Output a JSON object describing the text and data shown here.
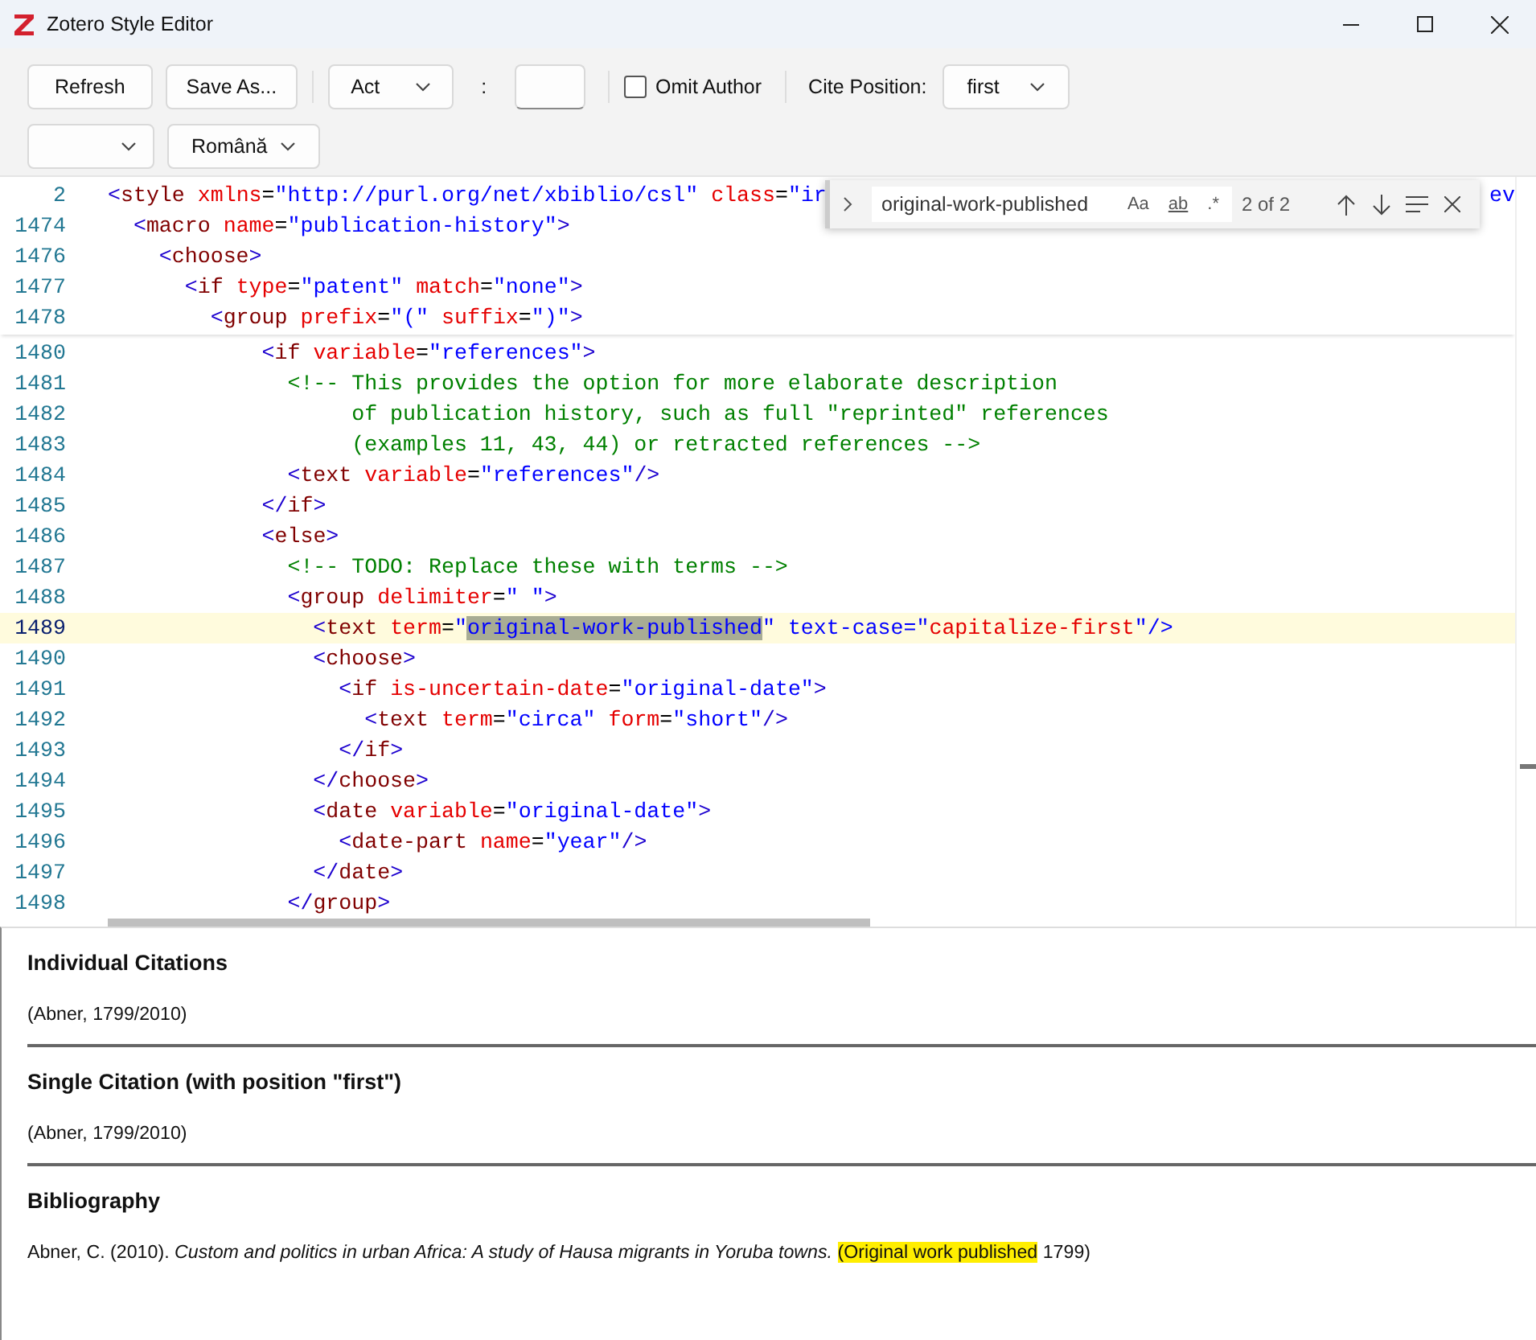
{
  "window": {
    "title": "Zotero Style Editor"
  },
  "toolbar": {
    "refresh": "Refresh",
    "save_as": "Save As...",
    "locator_type": "Act",
    "separator": ":",
    "omit_author": {
      "label": "Omit Author",
      "checked": false
    },
    "cite_position": {
      "label": "Cite Position:",
      "value": "first"
    },
    "language": "Română"
  },
  "editor": {
    "sticky_lines": [
      {
        "number": "2",
        "segments": [
          {
            "kind": "markup",
            "text": "<style xmlns=\"http://purl.org/net/xbiblio/csl\" class=\"ir"
          }
        ],
        "tail": "ev",
        "current": false
      },
      {
        "number": "1474",
        "segments": [
          {
            "kind": "markup",
            "text": "  <macro name=\"publication-history\">"
          }
        ],
        "current": false
      },
      {
        "number": "1476",
        "segments": [
          {
            "kind": "markup",
            "text": "    <choose>"
          }
        ],
        "current": false
      },
      {
        "number": "1477",
        "segments": [
          {
            "kind": "markup",
            "text": "      <if type=\"patent\" match=\"none\">"
          }
        ],
        "current": false
      },
      {
        "number": "1478",
        "segments": [
          {
            "kind": "markup",
            "text": "        <group prefix=\"(\" suffix=\")\">"
          }
        ],
        "current": false
      }
    ],
    "lines": [
      {
        "number": "1480",
        "segments": [
          {
            "kind": "markup",
            "text": "            <if variable=\"references\">"
          }
        ],
        "current": false
      },
      {
        "number": "1481",
        "segments": [
          {
            "kind": "comment",
            "text": "              <!-- This provides the option for more elaborate description"
          }
        ],
        "current": false
      },
      {
        "number": "1482",
        "segments": [
          {
            "kind": "comment",
            "text": "                   of publication history, such as full \"reprinted\" references"
          }
        ],
        "current": false
      },
      {
        "number": "1483",
        "segments": [
          {
            "kind": "comment",
            "text": "                   (examples 11, 43, 44) or retracted references -->"
          }
        ],
        "current": false
      },
      {
        "number": "1484",
        "segments": [
          {
            "kind": "markup",
            "text": "              <text variable=\"references\"/>"
          }
        ],
        "current": false
      },
      {
        "number": "1485",
        "segments": [
          {
            "kind": "markup",
            "text": "            </if>"
          }
        ],
        "current": false
      },
      {
        "number": "1486",
        "segments": [
          {
            "kind": "markup",
            "text": "            <else>"
          }
        ],
        "current": false
      },
      {
        "number": "1487",
        "segments": [
          {
            "kind": "comment",
            "text": "              <!-- TODO: Replace these with terms -->"
          }
        ],
        "current": false
      },
      {
        "number": "1488",
        "segments": [
          {
            "kind": "markup",
            "text": "              <group delimiter=\" \">"
          }
        ],
        "current": false
      },
      {
        "number": "1489",
        "segments": [
          {
            "kind": "markup",
            "text": "                <text term=\""
          },
          {
            "kind": "match",
            "text": "original-work-published"
          },
          {
            "kind": "markup",
            "text": "\" text-case=\"capitalize-first\"/>"
          }
        ],
        "current": true
      },
      {
        "number": "1490",
        "segments": [
          {
            "kind": "markup",
            "text": "                <choose>"
          }
        ],
        "current": false
      },
      {
        "number": "1491",
        "segments": [
          {
            "kind": "markup",
            "text": "                  <if is-uncertain-date=\"original-date\">"
          }
        ],
        "current": false
      },
      {
        "number": "1492",
        "segments": [
          {
            "kind": "markup",
            "text": "                    <text term=\"circa\" form=\"short\"/>"
          }
        ],
        "current": false
      },
      {
        "number": "1493",
        "segments": [
          {
            "kind": "markup",
            "text": "                  </if>"
          }
        ],
        "current": false
      },
      {
        "number": "1494",
        "segments": [
          {
            "kind": "markup",
            "text": "                </choose>"
          }
        ],
        "current": false
      },
      {
        "number": "1495",
        "segments": [
          {
            "kind": "markup",
            "text": "                <date variable=\"original-date\">"
          }
        ],
        "current": false
      },
      {
        "number": "1496",
        "segments": [
          {
            "kind": "markup",
            "text": "                  <date-part name=\"year\"/>"
          }
        ],
        "current": false
      },
      {
        "number": "1497",
        "segments": [
          {
            "kind": "markup",
            "text": "                </date>"
          }
        ],
        "current": false
      },
      {
        "number": "1498",
        "segments": [
          {
            "kind": "markup",
            "text": "              </group>"
          }
        ],
        "current": false
      }
    ],
    "find": {
      "value": "original-work-published",
      "options": [
        {
          "label": "Aa",
          "selected": false
        },
        {
          "label": "ab",
          "selected": false
        },
        {
          "label": ".*",
          "selected": false
        }
      ],
      "count": "2 of 2"
    }
  },
  "preview": {
    "sections": [
      {
        "heading": "Individual Citations",
        "entries": [
          [
            {
              "text": "(Abner, 1799/2010)",
              "highlighted": false
            }
          ]
        ]
      },
      {
        "heading": "Single Citation (with position \"first\")",
        "entries": [
          [
            {
              "text": "(Abner, 1799/2010)",
              "highlighted": false
            }
          ]
        ]
      },
      {
        "heading": "Bibliography",
        "entries": [
          [
            {
              "text": "Abner, C. (2010). *Custom and politics in urban Africa: A study of Hausa migrants in Yoruba towns.* ",
              "highlighted": false
            },
            {
              "text": "(Original work published",
              "highlighted": true
            },
            {
              "text": " 1799)",
              "highlighted": false
            }
          ]
        ]
      }
    ]
  }
}
